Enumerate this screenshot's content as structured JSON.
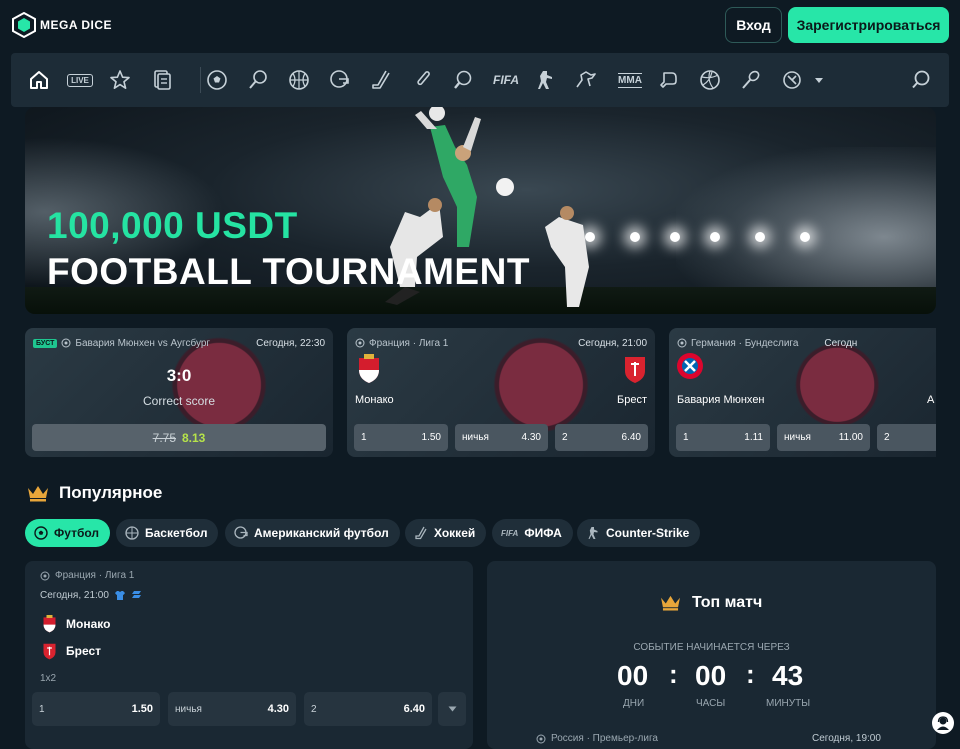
{
  "header": {
    "logo_text": "MEGA DICE",
    "login_label": "Вход",
    "register_label": "Зарегистрироваться"
  },
  "sport_nav": {
    "icons": [
      "home-icon",
      "live-icon",
      "star-icon",
      "betslip-icon",
      "football-icon",
      "tennis-icon",
      "basketball-icon",
      "american-football-icon",
      "hockey-icon",
      "cricket-icon",
      "table-tennis-icon",
      "fifa-icon",
      "counter-strike-icon",
      "horse-racing-icon",
      "mma-icon",
      "boxing-icon",
      "volleyball-icon",
      "badminton-icon",
      "more-sports-icon",
      "search-icon"
    ],
    "live_label": "LIVE",
    "fifa_label": "FIFA",
    "mma_label": "MMA"
  },
  "banner": {
    "line1": "100,000 USDT",
    "line2": "FOOTBALL TOURNAMENT"
  },
  "featured": [
    {
      "badge": "БУСТ",
      "title": "Бавария Мюнхен vs Аугсбург",
      "time": "Сегодня, 22:30",
      "score": "3:0",
      "market": "Correct score",
      "old_odd": "7.75",
      "new_odd": "8.13"
    },
    {
      "league": "Франция · Лига 1",
      "time": "Сегодня, 21:00",
      "home": "Монако",
      "away": "Брест",
      "odds": [
        {
          "label": "1",
          "value": "1.50"
        },
        {
          "label": "ничья",
          "value": "4.30"
        },
        {
          "label": "2",
          "value": "6.40"
        }
      ]
    },
    {
      "league": "Германия · Бундеслига",
      "time": "Сегодн",
      "home": "Бавария Мюнхен",
      "away": "А",
      "odds": [
        {
          "label": "1",
          "value": "1.11"
        },
        {
          "label": "ничья",
          "value": "11.00"
        },
        {
          "label": "2",
          "value": ""
        }
      ]
    }
  ],
  "popular": {
    "title": "Популярное",
    "chips": [
      {
        "label": "Футбол",
        "icon": "football-icon"
      },
      {
        "label": "Баскетбол",
        "icon": "basketball-icon"
      },
      {
        "label": "Американский футбол",
        "icon": "american-football-icon"
      },
      {
        "label": "Хоккей",
        "icon": "hockey-icon"
      },
      {
        "label": "ФИФА",
        "icon": "fifa-icon",
        "prefix": "FIFA"
      },
      {
        "label": "Counter-Strike",
        "icon": "counter-strike-icon"
      }
    ]
  },
  "match": {
    "league": "Франция · Лига 1",
    "time": "Сегодня, 21:00",
    "home": "Монако",
    "away": "Брест",
    "market": "1x2",
    "odds": [
      {
        "label": "1",
        "value": "1.50"
      },
      {
        "label": "ничья",
        "value": "4.30"
      },
      {
        "label": "2",
        "value": "6.40"
      }
    ]
  },
  "top_match": {
    "title": "Топ матч",
    "countdown_label": "СОБЫТИЕ НАЧИНАЕТСЯ ЧЕРЕЗ",
    "days": "00",
    "hours": "00",
    "minutes": "43",
    "days_label": "ДНИ",
    "hours_label": "ЧАСЫ",
    "minutes_label": "МИНУТЫ",
    "league": "Россия · Премьер-лига",
    "time": "Сегодня, 19:00"
  },
  "colors": {
    "accent": "#27e6a8",
    "background": "#0e1a23",
    "panel": "#1d2c37",
    "crown": "#e8a63a"
  }
}
